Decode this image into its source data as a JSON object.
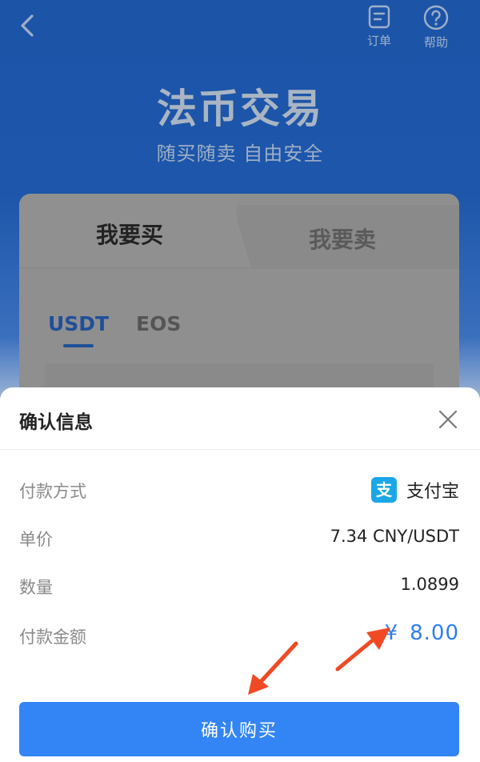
{
  "topbar": {
    "orders_label": "订单",
    "help_label": "帮助"
  },
  "hero": {
    "title": "法币交易",
    "subtitle": "随买随卖 自由安全"
  },
  "trade_card": {
    "tabs": [
      {
        "label": "我要买",
        "active": true
      },
      {
        "label": "我要卖",
        "active": false
      }
    ],
    "coins": [
      {
        "label": "USDT",
        "active": true
      },
      {
        "label": "EOS",
        "active": false
      }
    ]
  },
  "sheet": {
    "title": "确认信息",
    "rows": {
      "payment_method": {
        "label": "付款方式",
        "value": "支付宝"
      },
      "unit_price": {
        "label": "单价",
        "value": "7.34 CNY/USDT"
      },
      "quantity": {
        "label": "数量",
        "value": "1.0899"
      },
      "amount": {
        "label": "付款金额",
        "currency": "¥",
        "value": "8.00"
      }
    },
    "confirm_label": "确认购买"
  },
  "colors": {
    "primary": "#3384f5",
    "amount": "#2e7ef0",
    "annotation_arrow": "#f04a24",
    "alipay": "#1aa7e8"
  },
  "icons": {
    "back": "chevron-left-icon",
    "orders": "document-icon",
    "help": "question-circle-icon",
    "close": "close-icon",
    "alipay": "alipay-icon"
  }
}
